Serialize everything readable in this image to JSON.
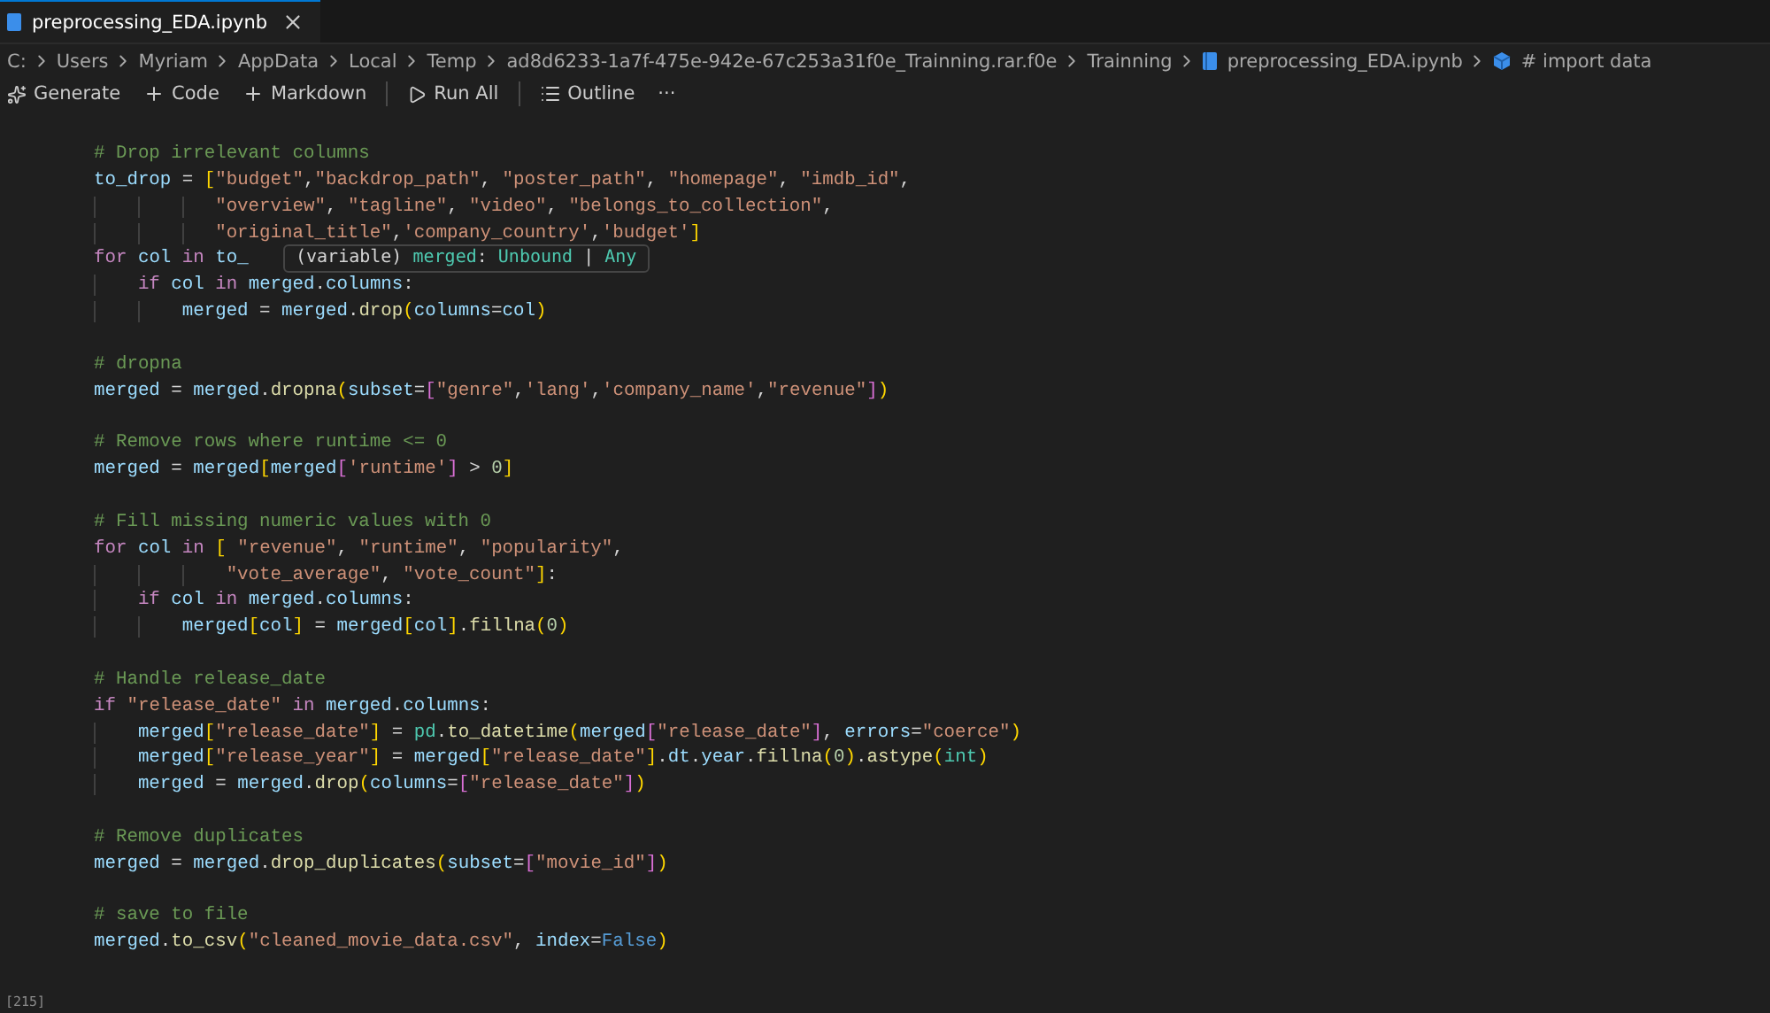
{
  "tab": {
    "title": "preprocessing_EDA.ipynb",
    "selected": true
  },
  "breadcrumb": [
    {
      "kind": "folder",
      "label": "C:"
    },
    {
      "kind": "folder",
      "label": "Users"
    },
    {
      "kind": "folder",
      "label": "Myriam"
    },
    {
      "kind": "folder",
      "label": "AppData"
    },
    {
      "kind": "folder",
      "label": "Local"
    },
    {
      "kind": "folder",
      "label": "Temp"
    },
    {
      "kind": "folder",
      "label": "ad8d6233-1a7f-475e-942e-67c253a31f0e_Trainning.rar.f0e"
    },
    {
      "kind": "folder",
      "label": "Trainning"
    },
    {
      "kind": "notebook",
      "label": "preprocessing_EDA.ipynb"
    },
    {
      "kind": "cell",
      "label": "# import data"
    }
  ],
  "toolbar": [
    {
      "kind": "sparkle",
      "label": "Generate"
    },
    {
      "kind": "plus",
      "label": "Code"
    },
    {
      "kind": "plus",
      "label": "Markdown"
    },
    {
      "kind": "separator"
    },
    {
      "kind": "play",
      "label": "Run All"
    },
    {
      "kind": "separator"
    },
    {
      "kind": "list",
      "label": "Outline"
    },
    {
      "kind": "more",
      "label": "···"
    }
  ],
  "cell": {
    "execution_count": "[215]",
    "lines": [
      {
        "kind": "code",
        "tokens": [
          {
            "kind": "comment",
            "text": "# Drop irrelevant columns"
          }
        ]
      },
      {
        "kind": "code",
        "tokens": [
          {
            "kind": "var",
            "text": "to_drop"
          },
          {
            "kind": "op",
            "text": " = "
          },
          {
            "kind": "b1",
            "text": "["
          },
          {
            "kind": "str",
            "text": "\"budget\""
          },
          {
            "kind": "op",
            "text": ","
          },
          {
            "kind": "str",
            "text": "\"backdrop_path\""
          },
          {
            "kind": "op",
            "text": ", "
          },
          {
            "kind": "str",
            "text": "\"poster_path\""
          },
          {
            "kind": "op",
            "text": ", "
          },
          {
            "kind": "str",
            "text": "\"homepage\""
          },
          {
            "kind": "op",
            "text": ", "
          },
          {
            "kind": "str",
            "text": "\"imdb_id\""
          },
          {
            "kind": "op",
            "text": ","
          }
        ]
      },
      {
        "kind": "code",
        "tokens": [
          {
            "kind": "str",
            "text": "           \"overview\""
          },
          {
            "kind": "op",
            "text": ", "
          },
          {
            "kind": "str",
            "text": "\"tagline\""
          },
          {
            "kind": "op",
            "text": ", "
          },
          {
            "kind": "str",
            "text": "\"video\""
          },
          {
            "kind": "op",
            "text": ", "
          },
          {
            "kind": "str",
            "text": "\"belongs_to_collection\""
          },
          {
            "kind": "op",
            "text": ","
          }
        ]
      },
      {
        "kind": "code",
        "tokens": [
          {
            "kind": "str",
            "text": "           \"original_title\""
          },
          {
            "kind": "op",
            "text": ","
          },
          {
            "kind": "str",
            "text": "'company_country'"
          },
          {
            "kind": "op",
            "text": ","
          },
          {
            "kind": "str",
            "text": "'budget'"
          },
          {
            "kind": "b1",
            "text": "]"
          }
        ]
      },
      {
        "kind": "code",
        "tokens": [
          {
            "kind": "kw",
            "text": "for "
          },
          {
            "kind": "var",
            "text": "col "
          },
          {
            "kind": "kw",
            "text": "in "
          },
          {
            "kind": "var",
            "text": "to_"
          }
        ],
        "tooltip": [
          {
            "kind": "plain",
            "text": "(variable) "
          },
          {
            "kind": "type",
            "text": "merged"
          },
          {
            "kind": "plain",
            "text": ": "
          },
          {
            "kind": "type",
            "text": "Unbound"
          },
          {
            "kind": "plain",
            "text": " | "
          },
          {
            "kind": "type",
            "text": "Any"
          }
        ]
      },
      {
        "kind": "code",
        "tokens": [
          {
            "kind": "kw",
            "text": "    if "
          },
          {
            "kind": "var",
            "text": "col "
          },
          {
            "kind": "kw",
            "text": "in "
          },
          {
            "kind": "var",
            "text": "merged"
          },
          {
            "kind": "op",
            "text": "."
          },
          {
            "kind": "var",
            "text": "columns"
          },
          {
            "kind": "op",
            "text": ":"
          }
        ]
      },
      {
        "kind": "code",
        "tokens": [
          {
            "kind": "var",
            "text": "        merged"
          },
          {
            "kind": "op",
            "text": " = "
          },
          {
            "kind": "var",
            "text": "merged"
          },
          {
            "kind": "op",
            "text": "."
          },
          {
            "kind": "func",
            "text": "drop"
          },
          {
            "kind": "b1",
            "text": "("
          },
          {
            "kind": "var",
            "text": "columns"
          },
          {
            "kind": "op",
            "text": "="
          },
          {
            "kind": "var",
            "text": "col"
          },
          {
            "kind": "b1",
            "text": ")"
          }
        ]
      },
      {
        "kind": "blank"
      },
      {
        "kind": "code",
        "tokens": [
          {
            "kind": "comment",
            "text": "# dropna"
          }
        ]
      },
      {
        "kind": "code",
        "tokens": [
          {
            "kind": "var",
            "text": "merged"
          },
          {
            "kind": "op",
            "text": " = "
          },
          {
            "kind": "var",
            "text": "merged"
          },
          {
            "kind": "op",
            "text": "."
          },
          {
            "kind": "func",
            "text": "dropna"
          },
          {
            "kind": "b1",
            "text": "("
          },
          {
            "kind": "var",
            "text": "subset"
          },
          {
            "kind": "op",
            "text": "="
          },
          {
            "kind": "b2",
            "text": "["
          },
          {
            "kind": "str",
            "text": "\"genre\""
          },
          {
            "kind": "op",
            "text": ","
          },
          {
            "kind": "str",
            "text": "'lang'"
          },
          {
            "kind": "op",
            "text": ","
          },
          {
            "kind": "str",
            "text": "'company_name'"
          },
          {
            "kind": "op",
            "text": ","
          },
          {
            "kind": "str",
            "text": "\"revenue\""
          },
          {
            "kind": "b2",
            "text": "]"
          },
          {
            "kind": "b1",
            "text": ")"
          }
        ]
      },
      {
        "kind": "blank"
      },
      {
        "kind": "code",
        "tokens": [
          {
            "kind": "comment",
            "text": "# Remove rows where runtime <= 0"
          }
        ]
      },
      {
        "kind": "code",
        "tokens": [
          {
            "kind": "var",
            "text": "merged"
          },
          {
            "kind": "op",
            "text": " = "
          },
          {
            "kind": "var",
            "text": "merged"
          },
          {
            "kind": "b1",
            "text": "["
          },
          {
            "kind": "var",
            "text": "merged"
          },
          {
            "kind": "b2",
            "text": "["
          },
          {
            "kind": "str",
            "text": "'runtime'"
          },
          {
            "kind": "b2",
            "text": "]"
          },
          {
            "kind": "op",
            "text": " > "
          },
          {
            "kind": "num",
            "text": "0"
          },
          {
            "kind": "b1",
            "text": "]"
          }
        ]
      },
      {
        "kind": "blank"
      },
      {
        "kind": "code",
        "tokens": [
          {
            "kind": "comment",
            "text": "# Fill missing numeric values with 0"
          }
        ]
      },
      {
        "kind": "code",
        "tokens": [
          {
            "kind": "kw",
            "text": "for "
          },
          {
            "kind": "var",
            "text": "col "
          },
          {
            "kind": "kw",
            "text": "in "
          },
          {
            "kind": "b1",
            "text": "[ "
          },
          {
            "kind": "str",
            "text": "\"revenue\""
          },
          {
            "kind": "op",
            "text": ", "
          },
          {
            "kind": "str",
            "text": "\"runtime\""
          },
          {
            "kind": "op",
            "text": ", "
          },
          {
            "kind": "str",
            "text": "\"popularity\""
          },
          {
            "kind": "op",
            "text": ","
          }
        ]
      },
      {
        "kind": "code",
        "tokens": [
          {
            "kind": "str",
            "text": "            \"vote_average\""
          },
          {
            "kind": "op",
            "text": ", "
          },
          {
            "kind": "str",
            "text": "\"vote_count\""
          },
          {
            "kind": "b1",
            "text": "]"
          },
          {
            "kind": "op",
            "text": ":"
          }
        ]
      },
      {
        "kind": "code",
        "tokens": [
          {
            "kind": "kw",
            "text": "    if "
          },
          {
            "kind": "var",
            "text": "col "
          },
          {
            "kind": "kw",
            "text": "in "
          },
          {
            "kind": "var",
            "text": "merged"
          },
          {
            "kind": "op",
            "text": "."
          },
          {
            "kind": "var",
            "text": "columns"
          },
          {
            "kind": "op",
            "text": ":"
          }
        ]
      },
      {
        "kind": "code",
        "tokens": [
          {
            "kind": "var",
            "text": "        merged"
          },
          {
            "kind": "b1",
            "text": "["
          },
          {
            "kind": "var",
            "text": "col"
          },
          {
            "kind": "b1",
            "text": "]"
          },
          {
            "kind": "op",
            "text": " = "
          },
          {
            "kind": "var",
            "text": "merged"
          },
          {
            "kind": "b1",
            "text": "["
          },
          {
            "kind": "var",
            "text": "col"
          },
          {
            "kind": "b1",
            "text": "]"
          },
          {
            "kind": "op",
            "text": "."
          },
          {
            "kind": "func",
            "text": "fillna"
          },
          {
            "kind": "b1",
            "text": "("
          },
          {
            "kind": "num",
            "text": "0"
          },
          {
            "kind": "b1",
            "text": ")"
          }
        ]
      },
      {
        "kind": "blank"
      },
      {
        "kind": "code",
        "tokens": [
          {
            "kind": "comment",
            "text": "# Handle release_date"
          }
        ]
      },
      {
        "kind": "code",
        "tokens": [
          {
            "kind": "kw",
            "text": "if "
          },
          {
            "kind": "str",
            "text": "\"release_date\" "
          },
          {
            "kind": "kw",
            "text": "in "
          },
          {
            "kind": "var",
            "text": "merged"
          },
          {
            "kind": "op",
            "text": "."
          },
          {
            "kind": "var",
            "text": "columns"
          },
          {
            "kind": "op",
            "text": ":"
          }
        ]
      },
      {
        "kind": "code",
        "tokens": [
          {
            "kind": "var",
            "text": "    merged"
          },
          {
            "kind": "b1",
            "text": "["
          },
          {
            "kind": "str",
            "text": "\"release_date\""
          },
          {
            "kind": "b1",
            "text": "]"
          },
          {
            "kind": "op",
            "text": " = "
          },
          {
            "kind": "cls",
            "text": "pd"
          },
          {
            "kind": "op",
            "text": "."
          },
          {
            "kind": "func",
            "text": "to_datetime"
          },
          {
            "kind": "b1",
            "text": "("
          },
          {
            "kind": "var",
            "text": "merged"
          },
          {
            "kind": "b2",
            "text": "["
          },
          {
            "kind": "str",
            "text": "\"release_date\""
          },
          {
            "kind": "b2",
            "text": "]"
          },
          {
            "kind": "op",
            "text": ", "
          },
          {
            "kind": "var",
            "text": "errors"
          },
          {
            "kind": "op",
            "text": "="
          },
          {
            "kind": "str",
            "text": "\"coerce\""
          },
          {
            "kind": "b1",
            "text": ")"
          }
        ]
      },
      {
        "kind": "code",
        "tokens": [
          {
            "kind": "var",
            "text": "    merged"
          },
          {
            "kind": "b1",
            "text": "["
          },
          {
            "kind": "str",
            "text": "\"release_year\""
          },
          {
            "kind": "b1",
            "text": "]"
          },
          {
            "kind": "op",
            "text": " = "
          },
          {
            "kind": "var",
            "text": "merged"
          },
          {
            "kind": "b1",
            "text": "["
          },
          {
            "kind": "str",
            "text": "\"release_date\""
          },
          {
            "kind": "b1",
            "text": "]"
          },
          {
            "kind": "op",
            "text": "."
          },
          {
            "kind": "var",
            "text": "dt"
          },
          {
            "kind": "op",
            "text": "."
          },
          {
            "kind": "var",
            "text": "year"
          },
          {
            "kind": "op",
            "text": "."
          },
          {
            "kind": "func",
            "text": "fillna"
          },
          {
            "kind": "b1",
            "text": "("
          },
          {
            "kind": "num",
            "text": "0"
          },
          {
            "kind": "b1",
            "text": ")"
          },
          {
            "kind": "op",
            "text": "."
          },
          {
            "kind": "func",
            "text": "astype"
          },
          {
            "kind": "b1",
            "text": "("
          },
          {
            "kind": "cls",
            "text": "int"
          },
          {
            "kind": "b1",
            "text": ")"
          }
        ]
      },
      {
        "kind": "code",
        "tokens": [
          {
            "kind": "var",
            "text": "    merged"
          },
          {
            "kind": "op",
            "text": " = "
          },
          {
            "kind": "var",
            "text": "merged"
          },
          {
            "kind": "op",
            "text": "."
          },
          {
            "kind": "func",
            "text": "drop"
          },
          {
            "kind": "b1",
            "text": "("
          },
          {
            "kind": "var",
            "text": "columns"
          },
          {
            "kind": "op",
            "text": "="
          },
          {
            "kind": "b2",
            "text": "["
          },
          {
            "kind": "str",
            "text": "\"release_date\""
          },
          {
            "kind": "b2",
            "text": "]"
          },
          {
            "kind": "b1",
            "text": ")"
          }
        ]
      },
      {
        "kind": "blank"
      },
      {
        "kind": "code",
        "tokens": [
          {
            "kind": "comment",
            "text": "# Remove duplicates"
          }
        ]
      },
      {
        "kind": "code",
        "tokens": [
          {
            "kind": "var",
            "text": "merged"
          },
          {
            "kind": "op",
            "text": " = "
          },
          {
            "kind": "var",
            "text": "merged"
          },
          {
            "kind": "op",
            "text": "."
          },
          {
            "kind": "func",
            "text": "drop_duplicates"
          },
          {
            "kind": "b1",
            "text": "("
          },
          {
            "kind": "var",
            "text": "subset"
          },
          {
            "kind": "op",
            "text": "="
          },
          {
            "kind": "b2",
            "text": "["
          },
          {
            "kind": "str",
            "text": "\"movie_id\""
          },
          {
            "kind": "b2",
            "text": "]"
          },
          {
            "kind": "b1",
            "text": ")"
          }
        ]
      },
      {
        "kind": "blank"
      },
      {
        "kind": "code",
        "tokens": [
          {
            "kind": "comment",
            "text": "# save to file"
          }
        ]
      },
      {
        "kind": "code",
        "tokens": [
          {
            "kind": "var",
            "text": "merged"
          },
          {
            "kind": "op",
            "text": "."
          },
          {
            "kind": "func",
            "text": "to_csv"
          },
          {
            "kind": "b1",
            "text": "("
          },
          {
            "kind": "str",
            "text": "\"cleaned_movie_data.csv\""
          },
          {
            "kind": "op",
            "text": ", "
          },
          {
            "kind": "var",
            "text": "index"
          },
          {
            "kind": "op",
            "text": "="
          },
          {
            "kind": "const",
            "text": "False"
          },
          {
            "kind": "b1",
            "text": ")"
          }
        ]
      }
    ]
  }
}
